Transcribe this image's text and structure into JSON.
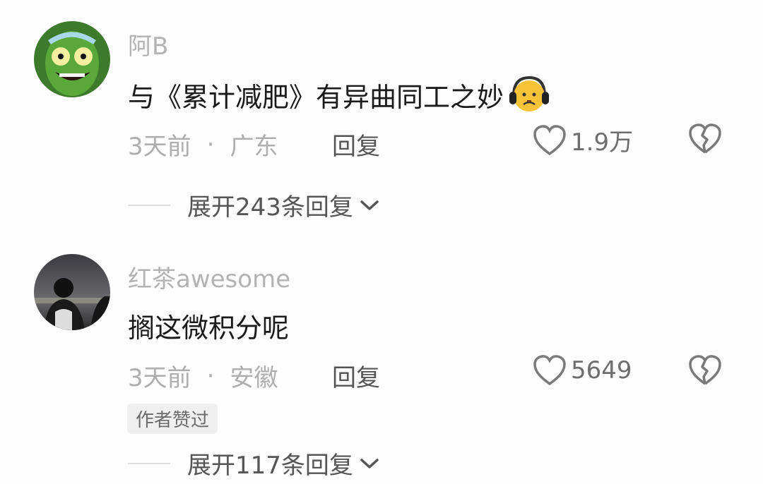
{
  "comments": [
    {
      "username": "阿B",
      "text": "与《累计减肥》有异曲同工之妙",
      "emoji": "sad-face-headphones-icon",
      "time": "3天前",
      "separator": "·",
      "location": "广东",
      "reply_label": "回复",
      "likes": "1.9万",
      "expand_label": "展开243条回复"
    },
    {
      "username": "红茶awesome",
      "text": "搁这微积分呢",
      "time": "3天前",
      "separator": "·",
      "location": "安徽",
      "reply_label": "回复",
      "likes": "5649",
      "badge": "作者赞过",
      "expand_label": "展开117条回复"
    }
  ],
  "colors": {
    "background": "#fdfdfd",
    "username": "#b3b3b3",
    "text": "#1b1b1b",
    "meta": "#aeaeae"
  }
}
